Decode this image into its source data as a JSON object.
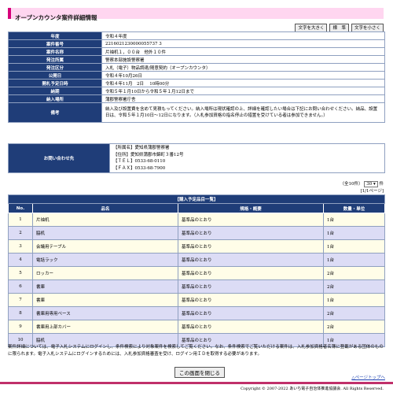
{
  "page_title": "オープンカウンタ案件詳細情報",
  "font_buttons": [
    "文字を大きく",
    "標　準",
    "文字を小さく"
  ],
  "info_rows": [
    {
      "label": "年度",
      "value": "令和４年度"
    },
    {
      "label": "案件番号",
      "value": "2216021230000055737 3"
    },
    {
      "label": "案件名称",
      "value": "片袖机１，００台　他外１０件"
    },
    {
      "label": "発注所属",
      "value": "警察本部施設警察署"
    },
    {
      "label": "発注区分",
      "value": "入札（電子）物品調達/随意契約（オープンカウンタ）"
    },
    {
      "label": "公開日",
      "value": "令和４年10月26日"
    },
    {
      "label": "開札予定日時",
      "value": "令和４年11月　2日　 10時00分"
    },
    {
      "label": "納期",
      "value": "令和５年１月10日から令和５年１月12日まで"
    },
    {
      "label": "納入場所",
      "value": "蒲郡警察署庁舎"
    },
    {
      "label": "備考",
      "value": "納入及び設置費を含めて見積もってください。納入場所は現状確認の上、詳細を確認したい場合は下記にお問い合わせください。納品、設置日は、令和５年１月10日～12日になります。（入札参加資格の指名停止の措置を受けている者は参加できません。）"
    }
  ],
  "contact": {
    "label": "お問い合わせ先",
    "lines": [
      "【所属名】愛知県蒲郡警察署",
      "【住所】愛知県蒲郡市錦町３番12号",
      "【ＴＥＬ】0533-68-0110",
      "【ＦＡＸ】0533-68-7900"
    ]
  },
  "counter": {
    "total_label": "（全10件）",
    "per_page": "30",
    "per_page_suffix": "件",
    "pages_label": "[1/1ページ]"
  },
  "items_table": {
    "caption": "【購入予定品目一覧】",
    "headers": [
      "No.",
      "品名",
      "規格・概要",
      "数量・単位"
    ],
    "rows": [
      {
        "no": "1",
        "name": "片袖机",
        "spec": "基準品のとおり",
        "qty": "1台"
      },
      {
        "no": "2",
        "name": "脇机",
        "spec": "基準品のとおり",
        "qty": "1台"
      },
      {
        "no": "3",
        "name": "会議用テーブル",
        "spec": "基準品のとおり",
        "qty": "1台"
      },
      {
        "no": "4",
        "name": "電話ラック",
        "spec": "基準品のとおり",
        "qty": "1台"
      },
      {
        "no": "5",
        "name": "ロッカー",
        "spec": "基準品のとおり",
        "qty": "2台"
      },
      {
        "no": "6",
        "name": "書庫",
        "spec": "基準品のとおり",
        "qty": "2台"
      },
      {
        "no": "7",
        "name": "書庫",
        "spec": "基準品のとおり",
        "qty": "1台"
      },
      {
        "no": "8",
        "name": "書庫用専用ベース",
        "spec": "基準品のとおり",
        "qty": "2台"
      },
      {
        "no": "9",
        "name": "書庫用上部カバー",
        "spec": "基準品のとおり",
        "qty": "2台"
      },
      {
        "no": "10",
        "name": "脇机",
        "spec": "基準品のとおり",
        "qty": "1台"
      }
    ]
  },
  "note": "案件詳細については、電子入札システムにログインし、条件検索により対象案件を検索してご覧ください。なお、条件検索でご覧いただける案件は、入札参加資格者名簿に登載がある団体のものに限られます。電子入札システムにログインするためには、入札参加資格審査を受け、ログイン用ＩＤを取得する必要があります。",
  "close_button": "この画面を閉じる",
  "to_top": "△ページトップへ",
  "footer": "Copyright © 2007-2022 あいち電子自治体推進協議会. All Rights Reserved."
}
